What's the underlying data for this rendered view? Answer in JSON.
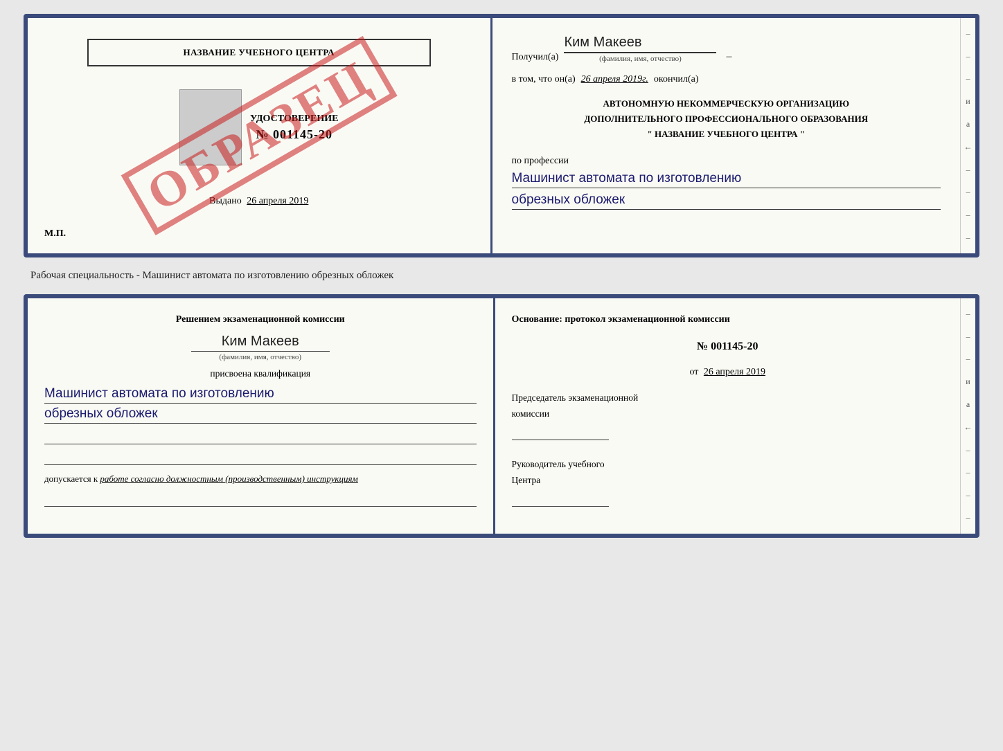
{
  "top_card": {
    "left": {
      "school_title": "НАЗВАНИЕ УЧЕБНОГО ЦЕНТРА",
      "cert_label": "УДОСТОВЕРЕНИЕ",
      "cert_number": "№ 001145-20",
      "issued_prefix": "Выдано",
      "issued_date": "26 апреля 2019",
      "mp_label": "М.П.",
      "stamp_text": "ОБРАЗЕЦ"
    },
    "right": {
      "received_label": "Получил(а)",
      "received_name": "Ким Макеев",
      "fio_label": "(фамилия, имя, отчество)",
      "date_prefix": "в том, что он(а)",
      "date_value": "26 апреля 2019г.",
      "date_suffix": "окончил(а)",
      "org_line1": "АВТОНОМНУЮ НЕКОММЕРЧЕСКУЮ ОРГАНИЗАЦИЮ",
      "org_line2": "ДОПОЛНИТЕЛЬНОГО ПРОФЕССИОНАЛЬНОГО ОБРАЗОВАНИЯ",
      "org_line3": "\"  НАЗВАНИЕ УЧЕБНОГО ЦЕНТРА  \"",
      "profession_label": "по профессии",
      "profession_hw_1": "Машинист автомата по изготовлению",
      "profession_hw_2": "обрезных обложек"
    }
  },
  "caption": "Рабочая специальность - Машинист автомата по изготовлению обрезных обложек",
  "bottom_card": {
    "left": {
      "commission_line1": "Решением экзаменационной комиссии",
      "person_name": "Ким Макеев",
      "fio_label": "(фамилия, имя, отчество)",
      "qualification_label": "присвоена квалификация",
      "qualification_hw_1": "Машинист автомата по изготовлению",
      "qualification_hw_2": "обрезных обложек",
      "allowed_text_prefix": "допускается к",
      "allowed_text_italic": "работе согласно должностным (производственным) инструкциям"
    },
    "right": {
      "basis_label": "Основание: протокол экзаменационной комиссии",
      "protocol_number": "№  001145-20",
      "protocol_date_prefix": "от",
      "protocol_date": "26 апреля 2019",
      "chairman_label_1": "Председатель экзаменационной",
      "chairman_label_2": "комиссии",
      "director_label_1": "Руководитель учебного",
      "director_label_2": "Центра"
    }
  },
  "deco_chars": [
    "-",
    "-",
    "-",
    "и",
    "а",
    "←",
    "-",
    "-",
    "-",
    "-"
  ]
}
